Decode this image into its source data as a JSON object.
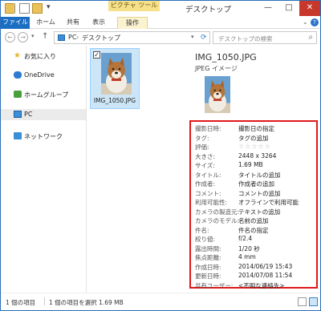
{
  "window": {
    "title": "デスクトップ",
    "tool_group": "ピクチャ ツール",
    "min_glyph": "—",
    "max_glyph": "□",
    "close_glyph": "✕"
  },
  "ribbon": {
    "tabs": [
      "ファイル",
      "ホーム",
      "共有",
      "表示",
      "操作"
    ]
  },
  "address": {
    "crumbs": [
      "PC",
      "デスクトップ"
    ],
    "separator": "›",
    "search_placeholder": "デスクトップの検索"
  },
  "nav_pane": {
    "items": [
      {
        "label": "お気に入り",
        "icon": "star-icon"
      },
      {
        "label": "OneDrive",
        "icon": "cloud-icon"
      },
      {
        "label": "ホームグループ",
        "icon": "homegroup-icon"
      },
      {
        "label": "PC",
        "icon": "pc-icon"
      },
      {
        "label": "ネットワーク",
        "icon": "network-icon"
      }
    ]
  },
  "file": {
    "name": "IMG_1050.JPG",
    "checked": "✓"
  },
  "details": {
    "title": "IMG_1050.JPG",
    "type": "JPEG イメージ",
    "properties": [
      {
        "key": "撮影日時:",
        "value": "撮影日の指定"
      },
      {
        "key": "タグ:",
        "value": "タグの追加"
      },
      {
        "key": "評価:",
        "value": "☆☆☆☆☆"
      },
      {
        "key": "大きさ:",
        "value": "2448 x 3264"
      },
      {
        "key": "サイズ:",
        "value": "1.69 MB"
      },
      {
        "key": "タイトル:",
        "value": "タイトルの追加"
      },
      {
        "key": "作成者:",
        "value": "作成者の追加"
      },
      {
        "key": "コメント:",
        "value": "コメントの追加"
      },
      {
        "key": "利用可能性:",
        "value": "オフラインで利用可能"
      },
      {
        "key": "カメラの製造元:",
        "value": "テキストの追加"
      },
      {
        "key": "カメラのモデル:",
        "value": "名前の追加"
      },
      {
        "key": "件名:",
        "value": "件名の指定"
      },
      {
        "key": "絞り値:",
        "value": "f/2.4"
      },
      {
        "key": "露出時間:",
        "value": "1/20 秒"
      },
      {
        "key": "焦点距離:",
        "value": "4 mm"
      },
      {
        "key": "作成日時:",
        "value": "2014/06/19 15:43"
      },
      {
        "key": "更新日時:",
        "value": "2014/07/08 11:54"
      },
      {
        "key": "共有ユーザー:",
        "value": "<不明な連絡先>"
      }
    ]
  },
  "status": {
    "count": "1 個の項目",
    "selected": "1 個の項目を選択  1.69 MB"
  },
  "colors": {
    "accent": "#1c6ec2",
    "highlight_box": "#e01818",
    "selection": "#cde6f7"
  }
}
